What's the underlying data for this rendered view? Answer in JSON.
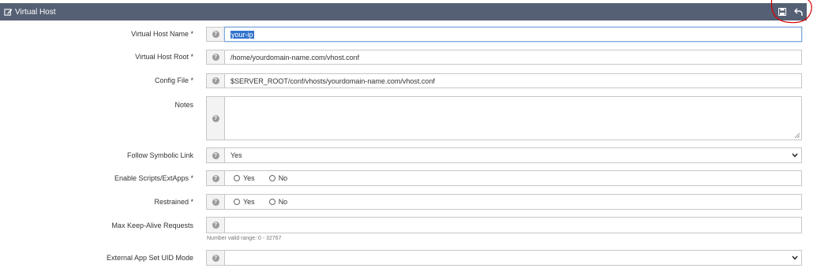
{
  "panel": {
    "title": "Virtual Host"
  },
  "form": {
    "vhost_name": {
      "label": "Virtual Host Name *",
      "value": "your-ip"
    },
    "vhost_root": {
      "label": "Virtual Host Root *",
      "value": "/home/yourdomain-name.com/vhost.conf"
    },
    "config_file": {
      "label": "Config File *",
      "value": "$SERVER_ROOT/conf/vhosts/yourdomain-name.com/vhost.conf"
    },
    "notes": {
      "label": "Notes",
      "value": ""
    },
    "follow_symlink": {
      "label": "Follow Symbolic Link",
      "value": "Yes"
    },
    "enable_scripts": {
      "label": "Enable Scripts/ExtApps *",
      "option_yes": "Yes",
      "option_no": "No"
    },
    "restrained": {
      "label": "Restrained *",
      "option_yes": "Yes",
      "option_no": "No"
    },
    "max_keepalive": {
      "label": "Max Keep-Alive Requests",
      "value": "",
      "hint": "Number valid range: 0 - 32767"
    },
    "ext_app_uid": {
      "label": "External App Set UID Mode",
      "value": ""
    }
  },
  "icons": {
    "header_edit": "edit-icon",
    "save": "save-icon",
    "undo": "undo-icon",
    "help": "help-icon",
    "dropdown": "chevron-down-icon"
  },
  "colors": {
    "header_bg": "#566074",
    "selection": "#3373cc",
    "annotation": "#d40000"
  }
}
